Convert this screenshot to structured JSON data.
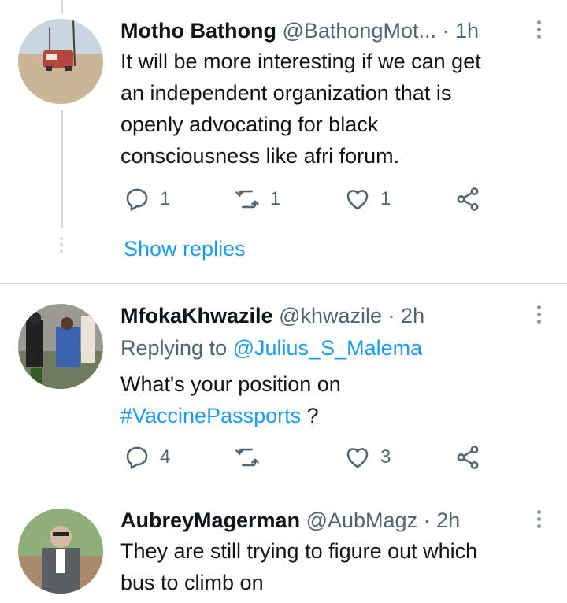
{
  "tweets": [
    {
      "name": "Motho Bathong",
      "handle": "@BathongMot...",
      "separator": "·",
      "time": "1h",
      "text_lines": [
        "It will be more interesting if we can get",
        "an independent organization that is",
        "openly advocating for black",
        "consciousness like afri forum."
      ],
      "reply_count": "1",
      "retweet_count": "1",
      "like_count": "1",
      "show_replies": "Show replies"
    },
    {
      "name": "MfokaKhwazile",
      "handle": "@khwazile",
      "separator": "·",
      "time": "2h",
      "replying_prefix": "Replying to",
      "replying_handle": "@Julius_S_Malema",
      "text_line1": "What's your position on",
      "hashtag": "#VaccinePassports",
      "text_suffix": " ?",
      "reply_count": "4",
      "retweet_count": "",
      "like_count": "3"
    },
    {
      "name": "AubreyMagerman",
      "handle": "@AubMagz",
      "separator": "·",
      "time": "2h",
      "text_lines": [
        "They are still trying to figure out which",
        "bus to climb on"
      ]
    }
  ],
  "icons": {
    "reply": "reply-icon",
    "retweet": "retweet-icon",
    "like": "heart-icon",
    "share": "share-icon",
    "more": "more-vertical-icon"
  },
  "colors": {
    "link": "#1d9bf0",
    "muted": "#536471",
    "thread_line": "#cfd9de"
  }
}
